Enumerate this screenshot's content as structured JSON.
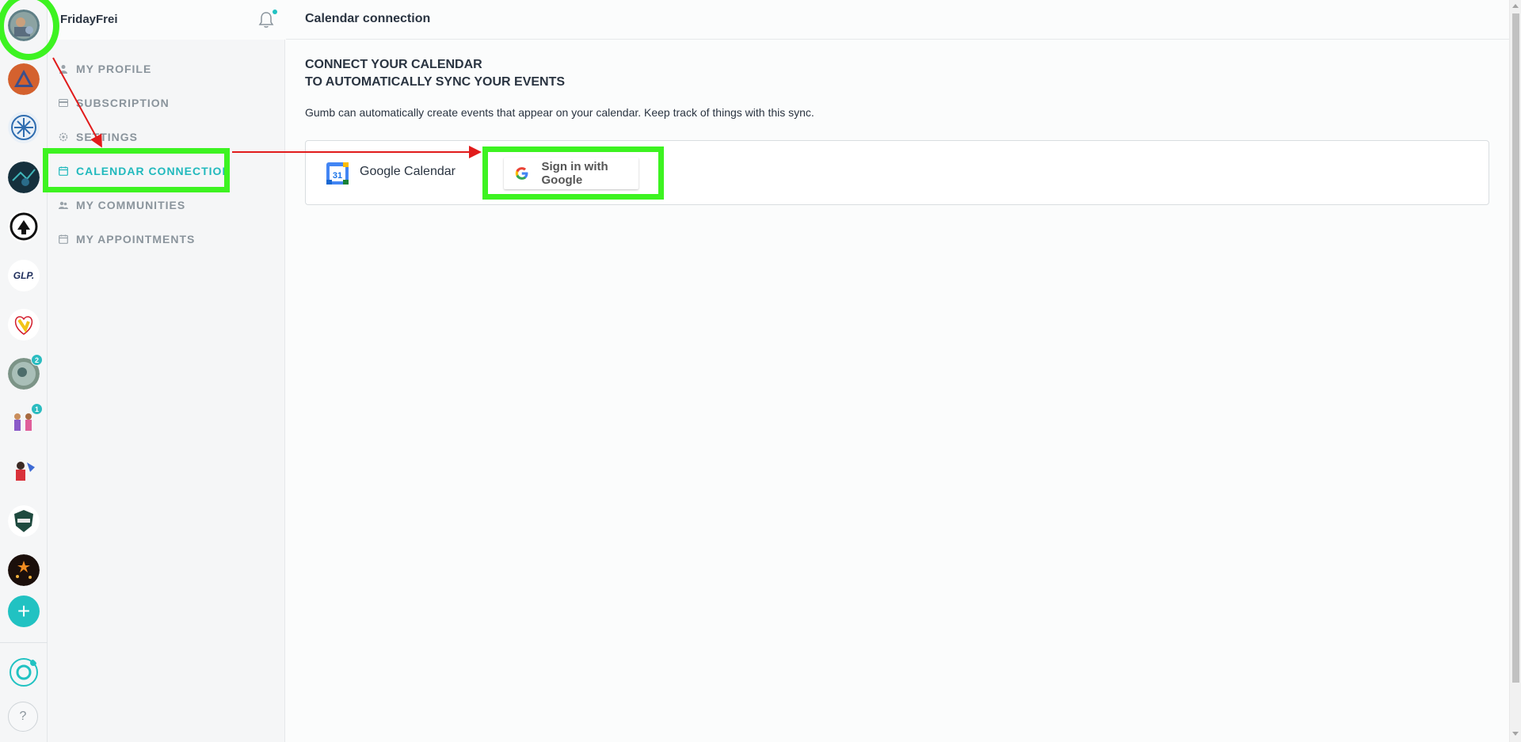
{
  "user": {
    "name": "FridayFrei",
    "avatar_icon": "user-avatar"
  },
  "rail": {
    "items": [
      {
        "name": "community-orange-triangle",
        "badge": ""
      },
      {
        "name": "community-snowflake",
        "badge": ""
      },
      {
        "name": "community-dark-blue",
        "badge": ""
      },
      {
        "name": "community-crest",
        "badge": ""
      },
      {
        "name": "community-glp",
        "badge": "",
        "text": "GLP."
      },
      {
        "name": "community-heart",
        "badge": ""
      },
      {
        "name": "community-photo",
        "badge": "2"
      },
      {
        "name": "community-people",
        "badge": "1"
      },
      {
        "name": "community-kids",
        "badge": ""
      },
      {
        "name": "community-shield",
        "badge": ""
      },
      {
        "name": "community-night",
        "badge": ""
      }
    ],
    "add_label": "+",
    "help_label": "?"
  },
  "sidebar": {
    "items": [
      {
        "label": "MY PROFILE",
        "icon": "person-icon",
        "active": false
      },
      {
        "label": "SUBSCRIPTION",
        "icon": "card-icon",
        "active": false
      },
      {
        "label": "SETTINGS",
        "icon": "gear-icon",
        "active": false
      },
      {
        "label": "CALENDAR CONNECTION",
        "icon": "calendar-icon",
        "active": true
      },
      {
        "label": "MY COMMUNITIES",
        "icon": "group-icon",
        "active": false
      },
      {
        "label": "MY APPOINTMENTS",
        "icon": "calendar-icon",
        "active": false
      }
    ]
  },
  "main": {
    "title": "Calendar connection",
    "heading_line1": "CONNECT YOUR CALENDAR",
    "heading_line2": "TO AUTOMATICALLY SYNC YOUR EVENTS",
    "description": "Gumb can automatically create events that appear on your calendar. Keep track of things with this sync.",
    "provider": {
      "label": "Google Calendar",
      "logo_text": "31"
    },
    "signin_label": "Sign in with Google"
  },
  "colors": {
    "accent": "#21c2c2",
    "highlight": "#3df321",
    "arrow": "#e11b1b"
  }
}
